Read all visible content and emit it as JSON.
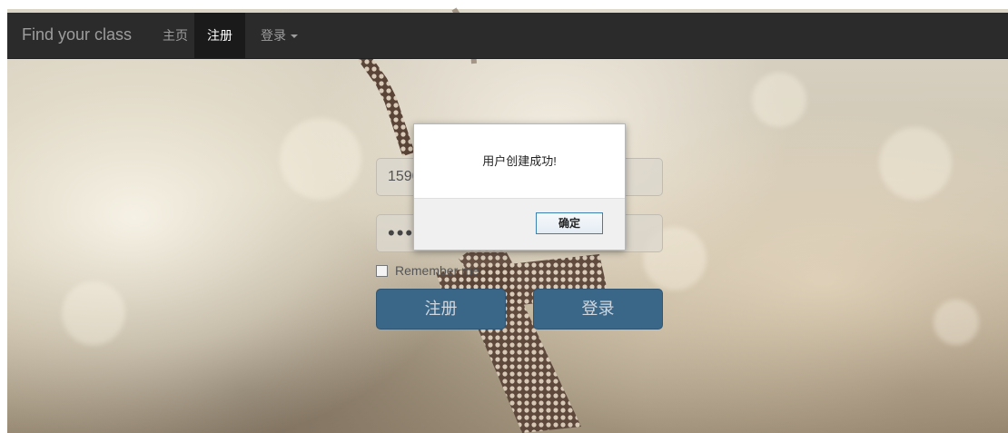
{
  "navbar": {
    "brand": "Find your class",
    "items": [
      {
        "label": "主页",
        "active": false
      },
      {
        "label": "注册",
        "active": true
      },
      {
        "label": "登录",
        "active": false,
        "dropdown": true
      }
    ]
  },
  "form": {
    "username_value": "1590",
    "password_value": "•••",
    "remember_label": "Remember me",
    "register_button": "注册",
    "login_button": "登录"
  },
  "dialog": {
    "message": "用户创建成功!",
    "ok_label": "确定"
  },
  "colors": {
    "navbar": "#2b2b2b",
    "button": "#3a6688",
    "dialog_border": "#3c7fb1"
  }
}
